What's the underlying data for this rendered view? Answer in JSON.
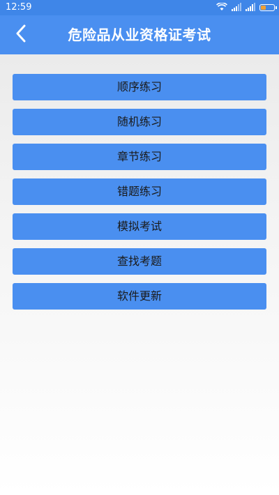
{
  "status_bar": {
    "time": "12:59",
    "icons": [
      "wifi-icon",
      "signal-icon",
      "signal-icon",
      "battery-icon"
    ],
    "battery_color": "#f1a034"
  },
  "header": {
    "title": "危险品从业资格证考试",
    "back_icon": "chevron-left-icon",
    "background": "#4a8ff0"
  },
  "menu": {
    "items": [
      {
        "label": "顺序练习"
      },
      {
        "label": "随机练习"
      },
      {
        "label": "章节练习"
      },
      {
        "label": "错题练习"
      },
      {
        "label": "模拟考试"
      },
      {
        "label": "查找考题"
      },
      {
        "label": "软件更新"
      }
    ],
    "button_color": "#4a8ff0"
  }
}
